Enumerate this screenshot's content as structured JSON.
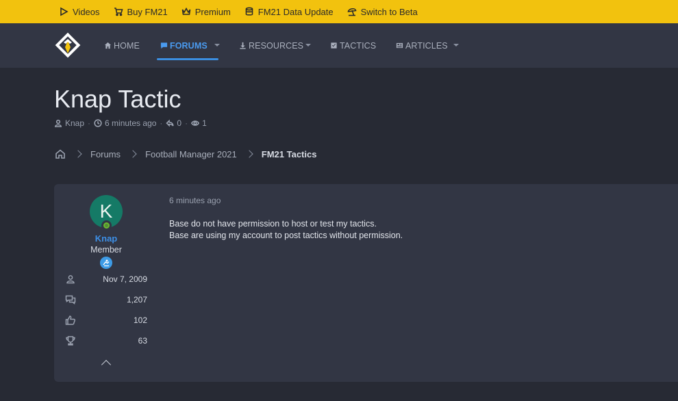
{
  "topbar": {
    "items": [
      {
        "label": "Videos",
        "icon": "play-icon"
      },
      {
        "label": "Buy FM21",
        "icon": "cart-icon"
      },
      {
        "label": "Premium",
        "icon": "crown-icon"
      },
      {
        "label": "FM21 Data Update",
        "icon": "database-icon"
      },
      {
        "label": "Switch to Beta",
        "icon": "umbrella-icon"
      }
    ],
    "color": "#f2c20e"
  },
  "nav": {
    "items": [
      {
        "label": "HOME",
        "icon": "home-icon",
        "active": false
      },
      {
        "label": "FORUMS",
        "icon": "chat-icon",
        "active": true
      },
      {
        "label": "RESOURCES",
        "icon": "download-icon",
        "active": false
      },
      {
        "label": "TACTICS",
        "icon": "checkbox-icon",
        "active": false
      },
      {
        "label": "ARTICLES",
        "icon": "newspaper-icon",
        "active": false
      }
    ],
    "accent": "#4a9bf0"
  },
  "thread": {
    "title": "Knap Tactic",
    "author": "Knap",
    "age": "6 minutes ago",
    "replies": "0",
    "views": "1"
  },
  "breadcrumb": {
    "items": [
      "Forums",
      "Football Manager 2021",
      "FM21 Tactics"
    ]
  },
  "post": {
    "avatar_letter": "K",
    "avatar_color": "#157a66",
    "username": "Knap",
    "user_title": "Member",
    "stats": [
      {
        "icon": "user-icon",
        "value": "Nov 7, 2009"
      },
      {
        "icon": "messages-icon",
        "value": "1,207"
      },
      {
        "icon": "thumbs-up-icon",
        "value": "102"
      },
      {
        "icon": "trophy-icon",
        "value": "63"
      }
    ],
    "date": "6 minutes ago",
    "body_lines": [
      "Base do not have permission to host or test my tactics.",
      "Base are using my account to post tactics without permission."
    ]
  }
}
